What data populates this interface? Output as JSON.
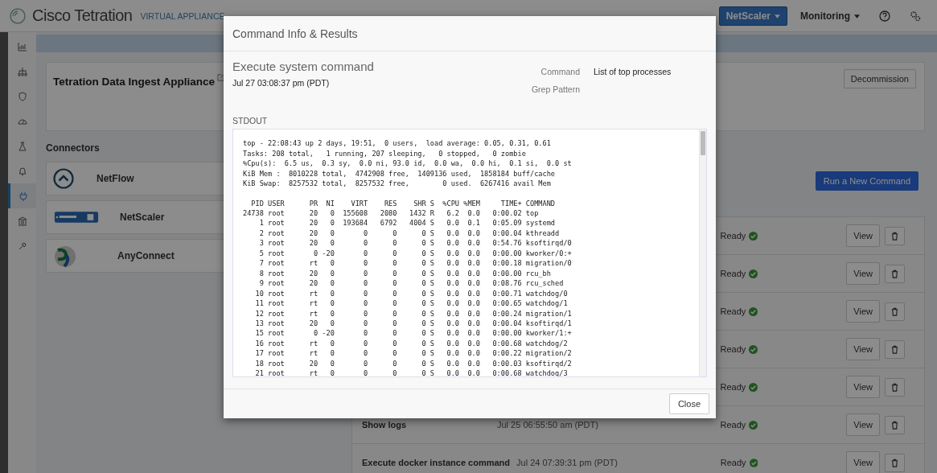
{
  "topbar": {
    "logo_text": "Cisco Tetration",
    "subtitle": "VIRTUAL APPLIANCE",
    "menus": [
      {
        "label": "NetScaler",
        "kind": "primary"
      },
      {
        "label": "Monitoring",
        "kind": "link"
      }
    ]
  },
  "sidebar": {
    "items": [
      {
        "selected": false
      },
      {
        "selected": false
      },
      {
        "selected": false
      },
      {
        "selected": false
      },
      {
        "selected": false
      },
      {
        "selected": false
      },
      {
        "selected": true
      },
      {
        "selected": false
      },
      {
        "selected": false
      }
    ]
  },
  "appliance": {
    "title": "Tetration Data Ingest Appliance",
    "action": "Decommission"
  },
  "connectors": {
    "heading": "Connectors",
    "items": [
      {
        "name": "NetFlow"
      },
      {
        "name": "NetScaler"
      },
      {
        "name": "AnyConnect"
      }
    ]
  },
  "commands": {
    "run_button": "Run a New Command",
    "rows": [
      {
        "status": "Ready",
        "view": "View"
      },
      {
        "status": "Ready",
        "view": "View"
      },
      {
        "status": "Ready",
        "view": "View"
      },
      {
        "status": "Ready",
        "view": "View"
      },
      {
        "status": "Ready",
        "view": "View"
      },
      {
        "name": "Show logs",
        "time": "Jul 25 06:55:50 am (PDT)",
        "status": "Ready",
        "view": "View"
      },
      {
        "name": "Execute docker instance command",
        "time": "Jul 24 07:39:31 pm (PDT)",
        "status": "Ready",
        "view": "View"
      }
    ]
  },
  "modal": {
    "title": "Command Info & Results",
    "command_type": "Execute system command",
    "timestamp": "Jul 27 03:08:37 pm (PDT)",
    "fields": [
      {
        "label": "Command",
        "value": "List of top processes"
      },
      {
        "label": "Grep Pattern"
      }
    ],
    "output_label": "STDOUT",
    "summary": [
      "top - 22:08:43 up 2 days, 19:51,  0 users,  load average: 0.05, 0.31, 0.61",
      "Tasks: 208 total,   1 running, 207 sleeping,   0 stopped,   0 zombie",
      "%Cpu(s):  6.5 us,  0.3 sy,  0.0 ni, 93.0 id,  0.0 wa,  0.0 hi,  0.1 si,  0.0 st",
      "KiB Mem :  8010228 total,  4742908 free,  1409136 used,  1858184 buff/cache",
      "KiB Swap:  8257532 total,  8257532 free,        0 used.  6267416 avail Mem"
    ],
    "process_header": "  PID USER      PR  NI    VIRT    RES    SHR S  %CPU %MEM     TIME+ COMMAND",
    "processes": [
      "24738 root      20   0  155608   2080   1432 R   6.2  0.0   0:00.02 top",
      "    1 root      20   0  193684   6792   4004 S   0.0  0.1   0:05.09 systemd",
      "    2 root      20   0       0      0      0 S   0.0  0.0   0:00.04 kthreadd",
      "    3 root      20   0       0      0      0 S   0.0  0.0   0:54.76 ksoftirqd/0",
      "    5 root       0 -20       0      0      0 S   0.0  0.0   0:00.00 kworker/0:+",
      "    7 root      rt   0       0      0      0 S   0.0  0.0   0:00.18 migration/0",
      "    8 root      20   0       0      0      0 S   0.0  0.0   0:00.00 rcu_bh",
      "    9 root      20   0       0      0      0 S   0.0  0.0   0:08.76 rcu_sched",
      "   10 root      rt   0       0      0      0 S   0.0  0.0   0:00.71 watchdog/0",
      "   11 root      rt   0       0      0      0 S   0.0  0.0   0:00.65 watchdog/1",
      "   12 root      rt   0       0      0      0 S   0.0  0.0   0:00.24 migration/1",
      "   13 root      20   0       0      0      0 S   0.0  0.0   0:00.04 ksoftirqd/1",
      "   15 root       0 -20       0      0      0 S   0.0  0.0   0:00.00 kworker/1:+",
      "   16 root      rt   0       0      0      0 S   0.0  0.0   0:00.68 watchdog/2",
      "   17 root      rt   0       0      0      0 S   0.0  0.0   0:00.22 migration/2",
      "   18 root      20   0       0      0      0 S   0.0  0.0   0:00.03 ksoftirqd/2",
      "   21 root      rt   0       0      0      0 S   0.0  0.0   0:00.68 watchdog/3"
    ],
    "close": "Close"
  }
}
